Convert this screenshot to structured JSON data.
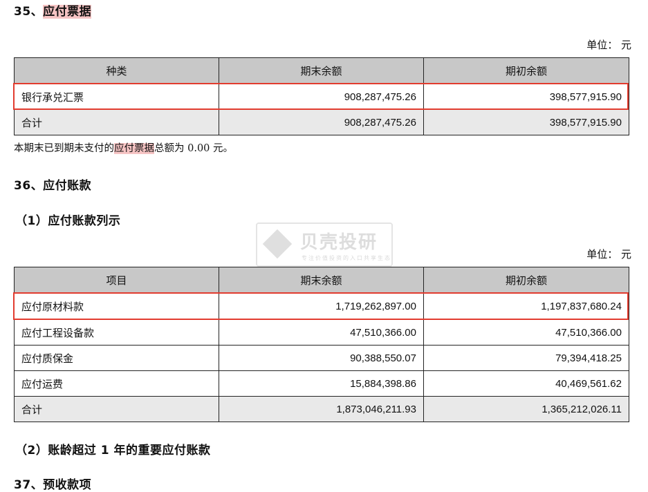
{
  "sec35": {
    "heading_prefix": "35、",
    "heading_highlight": "应付票据",
    "unit": "单位：  元",
    "headers": [
      "种类",
      "期末余额",
      "期初余额"
    ],
    "rows": [
      {
        "label": "银行承兑汇票",
        "end": "908,287,475.26",
        "begin": "398,577,915.90"
      },
      {
        "label": "合计",
        "end": "908,287,475.26",
        "begin": "398,577,915.90"
      }
    ],
    "note_pre": "本期末已到期未支付的",
    "note_hl": "应付票据",
    "note_post": "总额为 0.00 元。"
  },
  "sec36": {
    "heading": "36、应付账款",
    "sub1": "（1）应付账款列示",
    "unit": "单位：  元",
    "headers": [
      "项目",
      "期末余额",
      "期初余额"
    ],
    "rows": [
      {
        "label": "应付原材料款",
        "end": "1,719,262,897.00",
        "begin": "1,197,837,680.24"
      },
      {
        "label": "应付工程设备款",
        "end": "47,510,366.00",
        "begin": "47,510,366.00"
      },
      {
        "label": "应付质保金",
        "end": "90,388,550.07",
        "begin": "79,394,418.25"
      },
      {
        "label": "应付运费",
        "end": "15,884,398.86",
        "begin": "40,469,561.62"
      },
      {
        "label": "合计",
        "end": "1,873,046,211.93",
        "begin": "1,365,212,026.11"
      }
    ],
    "sub2": "（2）账龄超过 1 年的重要应付账款"
  },
  "sec37": {
    "heading": "37、预收款项"
  },
  "watermark": {
    "title": "贝壳投研",
    "subtitle": "专注价值投资的入口共享生态"
  },
  "colors": {
    "highlight": "#f6c4c4",
    "red_box": "#e23b2e",
    "header_bg": "#c8c8c8",
    "total_bg": "#e9e9e9"
  }
}
